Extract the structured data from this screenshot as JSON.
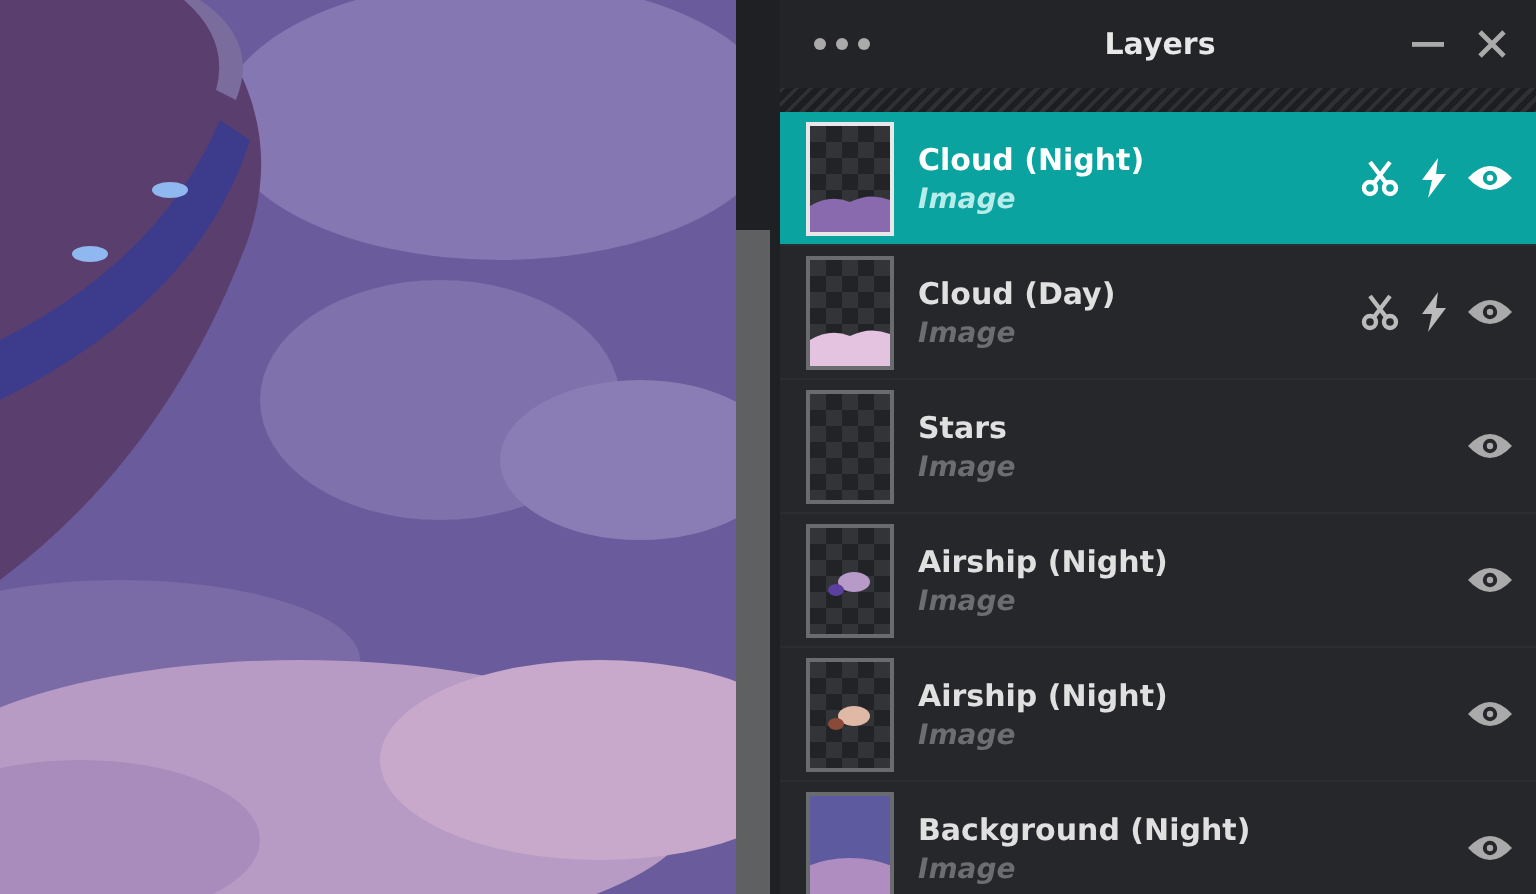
{
  "panel": {
    "title": "Layers"
  },
  "layers": [
    {
      "name": "Cloud (Night)",
      "type": "Image",
      "selected": true,
      "effects": true
    },
    {
      "name": "Cloud (Day)",
      "type": "Image",
      "selected": false,
      "effects": true
    },
    {
      "name": "Stars",
      "type": "Image",
      "selected": false,
      "effects": false
    },
    {
      "name": "Airship (Night)",
      "type": "Image",
      "selected": false,
      "effects": false
    },
    {
      "name": "Airship (Night)",
      "type": "Image",
      "selected": false,
      "effects": false
    },
    {
      "name": "Background (Night)",
      "type": "Image",
      "selected": false,
      "effects": false
    }
  ]
}
